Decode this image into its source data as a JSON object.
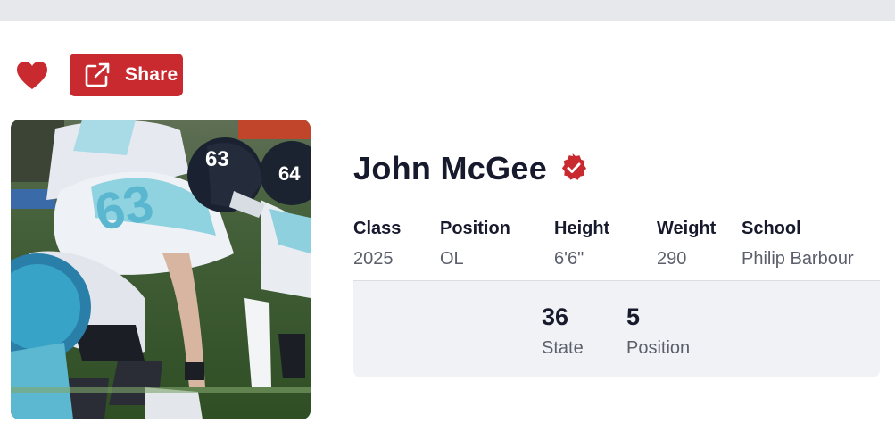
{
  "share": {
    "label": "Share",
    "icon": "external-link-icon",
    "color": "#c92a30"
  },
  "favorite": {
    "icon": "heart-icon",
    "color": "#c92a30"
  },
  "player": {
    "name": "John McGee",
    "verified_icon": "verified-badge-icon",
    "photo": "football-linemen-photo",
    "attributes": [
      {
        "label": "Class",
        "value": "2025"
      },
      {
        "label": "Position",
        "value": "OL"
      },
      {
        "label": "Height",
        "value": "6'6\""
      },
      {
        "label": "Weight",
        "value": "290"
      },
      {
        "label": "School",
        "value": "Philip Barbour"
      }
    ],
    "rankings": [
      {
        "value": "36",
        "label": "State"
      },
      {
        "value": "5",
        "label": "Position"
      }
    ]
  }
}
